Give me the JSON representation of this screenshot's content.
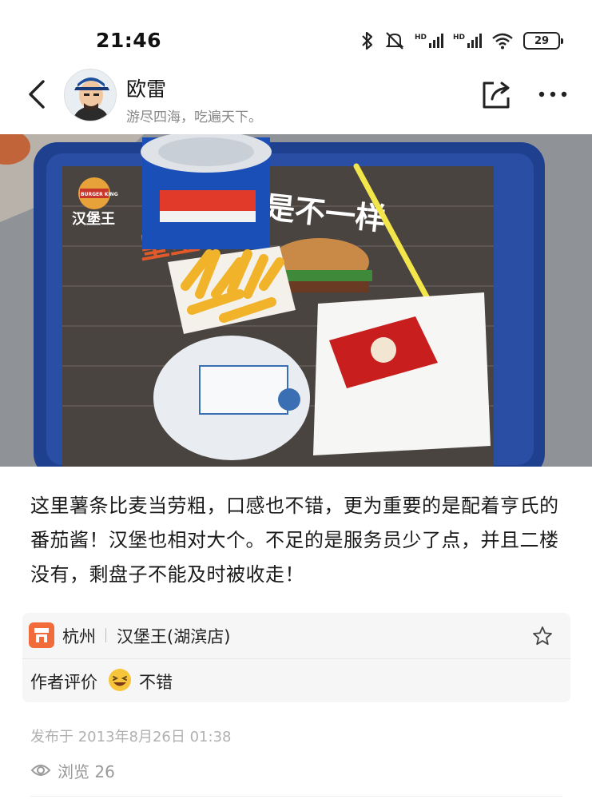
{
  "status_bar": {
    "time": "21:46",
    "battery": "29",
    "signal_label_1": "HD",
    "signal_label_2": "HD"
  },
  "header": {
    "author_name": "欧雷",
    "author_motto": "游尽四海，吃遍天下。"
  },
  "post": {
    "text": "这里薯条比麦当劳粗，口感也不错，更为重要的是配着亨氏的番茄酱！汉堡也相对大个。不足的是服务员少了点，并且二楼没有，剩盘子不能及时被收走！"
  },
  "location": {
    "city": "杭州",
    "shop": "汉堡王(湖滨店)"
  },
  "rating": {
    "label": "作者评价",
    "value": "不错"
  },
  "meta": {
    "publish": "发布于 2013年8月26日 01:38",
    "views": "浏览 26"
  },
  "photo_text": {
    "brand": "汉堡王",
    "brand_tag": "BURGER KING",
    "slogan": "是不一样",
    "placemat_slogan": "皇堡"
  },
  "colors": {
    "accent": "#f26b3a",
    "tray": "#1f3f8f"
  }
}
